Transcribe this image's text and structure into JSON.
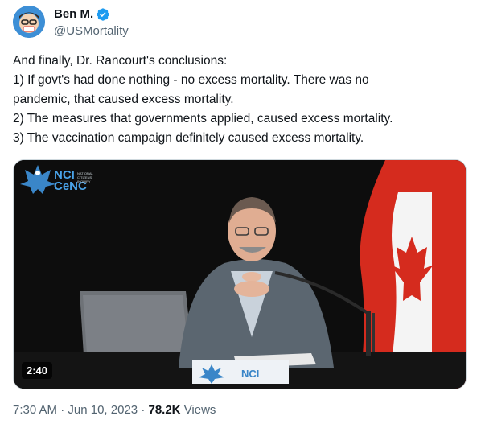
{
  "user": {
    "display_name": "Ben M.",
    "handle": "@USMortality",
    "verified": true,
    "verified_icon": "verified-badge-icon",
    "avatar_icon": "avatar-cartoon-icon"
  },
  "tweet": {
    "lines": [
      "And finally, Dr. Rancourt's conclusions:",
      "1) If govt's had done nothing - no excess mortality. There was no",
      "pandemic, that caused excess mortality.",
      "2) The measures that governments applied, caused excess mortality.",
      "3) The vaccination campaign definitely caused excess mortality."
    ]
  },
  "media": {
    "duration": "2:40",
    "logo_text_top": "NCI",
    "logo_text_bottom": "CeNC",
    "logo_subtitle": "NATIONAL CITIZENS INQUIRY",
    "placard_text": "NCI",
    "colors": {
      "flag_red": "#d52b1e",
      "logo_blue": "#4aa3e8"
    }
  },
  "meta": {
    "time": "7:30 AM",
    "separator": "·",
    "date": "Jun 10, 2023",
    "views_count": "78.2K",
    "views_label": "Views"
  },
  "colors": {
    "text": "#0f1419",
    "secondary": "#536471",
    "verified": "#1d9bf0"
  }
}
